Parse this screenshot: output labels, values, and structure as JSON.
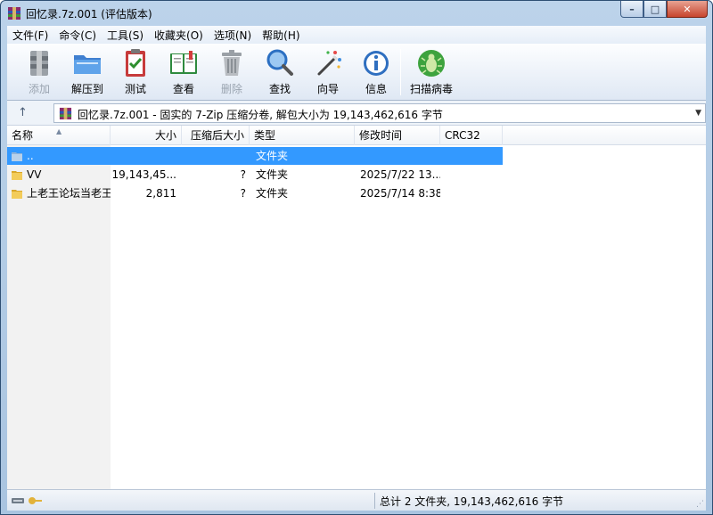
{
  "window": {
    "title": "回忆录.7z.001 (评估版本)",
    "controls": {
      "minimize": "–",
      "maximize": "□",
      "close": "✕"
    }
  },
  "menu": [
    "文件(F)",
    "命令(C)",
    "工具(S)",
    "收藏夹(O)",
    "选项(N)",
    "帮助(H)"
  ],
  "toolbar": {
    "add": {
      "label": "添加",
      "icon": "archive-add-icon",
      "enabled": false
    },
    "extract": {
      "label": "解压到",
      "icon": "folder-extract-icon",
      "enabled": true
    },
    "test": {
      "label": "测试",
      "icon": "clipboard-check-icon",
      "enabled": true
    },
    "view": {
      "label": "查看",
      "icon": "book-icon",
      "enabled": true
    },
    "delete": {
      "label": "删除",
      "icon": "trash-icon",
      "enabled": false
    },
    "find": {
      "label": "查找",
      "icon": "magnifier-icon",
      "enabled": true
    },
    "wizard": {
      "label": "向导",
      "icon": "magic-wand-icon",
      "enabled": true
    },
    "info": {
      "label": "信息",
      "icon": "info-icon",
      "enabled": true
    },
    "virus_scan": {
      "label": "扫描病毒",
      "icon": "bug-icon",
      "enabled": true
    }
  },
  "address": {
    "up_arrow": "↑",
    "text": "回忆录.7z.001 - 固实的 7-Zip 压缩分卷, 解包大小为 19,143,462,616 字节",
    "dropdown": "▼"
  },
  "columns": {
    "name": "名称",
    "size": "大小",
    "packed": "压缩后大小",
    "type": "类型",
    "modified": "修改时间",
    "crc": "CRC32"
  },
  "files": [
    {
      "name": "..",
      "size": "",
      "packed": "",
      "type": "文件夹",
      "modified": "",
      "crc": "",
      "selected": true,
      "icon": "parent-folder-icon"
    },
    {
      "name": "VV",
      "size": "19,143,45...",
      "packed": "?",
      "type": "文件夹",
      "modified": "2025/7/22 13...",
      "crc": "",
      "selected": false,
      "icon": "folder-icon"
    },
    {
      "name": "上老王论坛当老王",
      "size": "2,811",
      "packed": "?",
      "type": "文件夹",
      "modified": "2025/7/14 8:38",
      "crc": "",
      "selected": false,
      "icon": "folder-icon"
    }
  ],
  "status": {
    "summary": "总计 2 文件夹, 19,143,462,616 字节",
    "grip": "⋰"
  },
  "colors": {
    "selection": "#3399ff",
    "frame": "#a9c4e0"
  }
}
